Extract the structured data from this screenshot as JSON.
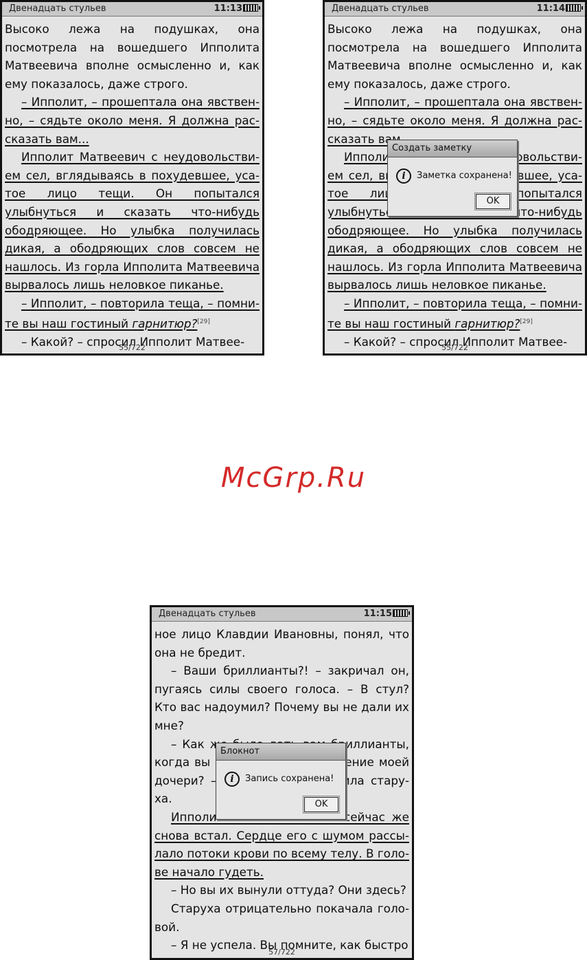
{
  "screen_a": {
    "book_title": "Двенадцать стульев",
    "time": "11:13",
    "page": "55/722",
    "p1": "Высоко лежа на подушках, она посмотре­ла на вошедшего Ипполита Матвеевича вполне осмысленно и, как ему показа­лось, даже строго.",
    "p2": "– Ипполит, – прошептала она явствен­но, – сядьте около меня. Я должна рас­сказать вам...",
    "p3": "Ипполит Матвеевич с неудовольстви­ем сел, вглядываясь в похудевшее, уса­тое лицо тещи. Он попытался улыбнуться и сказать что-нибудь ободряющее. Но улыбка получилась дикая, а ободряющих слов совсем не нашлось. Из горла Иппо­лита Матвеевича вырвалось лишь не­ловкое пиканье.",
    "p4_text": "– Ипполит, – повторила теща, – помни­те вы наш гостиный ",
    "p4_italic": "гарнитюр?",
    "p4_footnote": "[29]",
    "p5": "– Какой? – спросил Ипполит Матвее-"
  },
  "screen_b": {
    "book_title": "Двенадцать стульев",
    "time": "11:14",
    "page": "55/722",
    "p1": "Высоко лежа на подушках, она посмотре­ла на вошедшего Ипполита Матвеевича вполне осмысленно и, как ему показа­лось, даже строго.",
    "p2": "– Ипполит, – прошептала она явствен­но, – сядьте около меня. Я должна рас­сказать вам...",
    "p3": "Ипполит Матвеевич с неудовольстви­ем сел, вглядываясь в похудевшее, уса­тое лицо тещи. Он попытался улыбнуться и сказать что-нибудь ободряющее. Но улыбка получилась дикая, а ободряющих слов совсем не нашлось. Из горла Иппо­лита Матвеевича вырвалось лишь не­ловкое пиканье.",
    "p4_text": "– Ипполит, – повторила теща, – помни­те вы наш гостиный ",
    "p4_italic": "гарнитюр?",
    "p4_footnote": "[29]",
    "p5": "– Какой? – спросил Ипполит Матвее-",
    "dialog": {
      "title": "Создать заметку",
      "message": "Заметка сохранена!",
      "ok": "OK"
    }
  },
  "watermark": "McGrp.Ru",
  "screen_c": {
    "book_title": "Двенадцать стульев",
    "time": "11:15",
    "page": "57/722",
    "p1": "ное лицо Клавдии Ивановны, понял, что она не бредит.",
    "p2": "– Ваши бриллианты?! – закричал он, пу­гаясь силы своего голоса. – В стул? Кто вас надоумил? Почему вы не дали их мне?",
    "p3": "– Как же было дать вам бриллианты, когда вы пустили по ветру имение моей дочери? – спокойно проговорила стару­ха.",
    "p4": "Ипполит Матвеевич сел и сейчас же снова встал. Сердце его с шумом рассы­лало потоки крови по всему телу. В голо­ве начало гудеть.",
    "p5": "– Но вы их вынули оттуда? Они здесь?",
    "p6": "Старуха отрицательно покачала голо­вой.",
    "p7": "– Я не успела. Вы помните, как быстро",
    "dialog": {
      "title": "Блокнот",
      "message": "Запись сохранена!",
      "ok": "OK"
    }
  }
}
